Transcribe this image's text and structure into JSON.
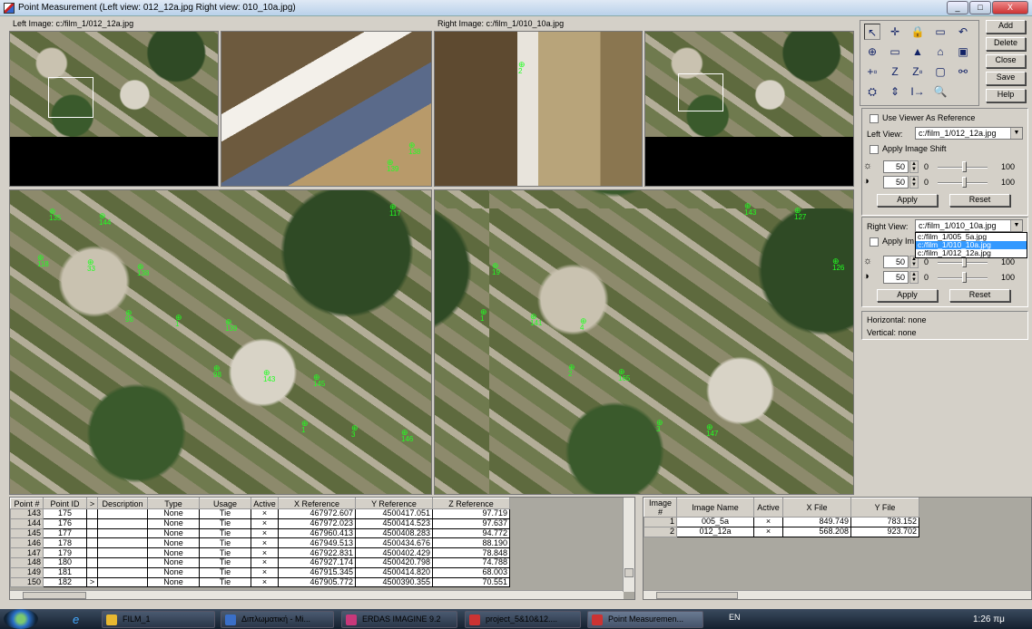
{
  "window": {
    "title": "Point Measurement (Left view: 012_12a.jpg  Right view: 010_10a.jpg)",
    "controls": [
      "_",
      "□",
      "X"
    ]
  },
  "views": {
    "left_label": "Left Image: c:/film_1/012_12a.jpg",
    "right_label": "Right Image: c:/film_1/010_10a.jpg",
    "markers_left_zoom": [
      "139"
    ],
    "markers_right_zoom": [
      "138",
      "2"
    ],
    "markers_left_main": [
      "118",
      "96",
      "98",
      "1",
      "117",
      "33",
      "1",
      "143",
      "3",
      "135",
      "138",
      "139",
      "145",
      "146",
      "144"
    ],
    "markers_right_main": [
      "1",
      "2",
      "3",
      "143",
      "126",
      "141",
      "165",
      "147",
      "127",
      "19",
      "4"
    ]
  },
  "tools": {
    "icons": [
      "select-arrow-icon",
      "crosshair-icon",
      "lock-icon",
      "viewer-icon",
      "undo-icon",
      "zoom-link-icon",
      "add-viewer-icon",
      "triangle-icon",
      "drive-icon",
      "layout-icon",
      "add-point-icon",
      "z-icon",
      "z-window-icon",
      "box-icon",
      "link-icon",
      "elevation-icon",
      "swap-icon",
      "transfer-icon",
      "find-icon"
    ],
    "glyphs": [
      "↖",
      "✛",
      "🔒",
      "▭",
      "↶",
      "⊕",
      "▭",
      "▲",
      "⌂",
      "▣",
      "+▫",
      "Z",
      "Z▫",
      "▢",
      "⚯",
      "⛭",
      "⇕",
      "I→",
      "🔍"
    ]
  },
  "buttons": {
    "add": "Add",
    "delete": "Delete",
    "close": "Close",
    "save": "Save",
    "help": "Help"
  },
  "left_controls": {
    "use_viewer_ref": "Use Viewer As Reference",
    "left_view_label": "Left View:",
    "left_view_value": "c:/film_1/012_12a.jpg",
    "apply_shift": "Apply Image Shift",
    "brightness": "50",
    "contrast": "50",
    "min": "0",
    "max": "100",
    "brightness_level": 50,
    "contrast_level": 50,
    "apply": "Apply",
    "reset": "Reset"
  },
  "right_controls": {
    "right_view_label": "Right View:",
    "right_view_value": "c:/film_1/010_10a.jpg",
    "apply_shift": "Apply Im",
    "brightness": "50",
    "contrast": "50",
    "min": "0",
    "max": "100",
    "brightness_level": 50,
    "contrast_level": 50,
    "apply": "Apply",
    "reset": "Reset",
    "dropdown_options": [
      "c:/film_1/005_5a.jpg",
      "c:/film_1/010_10a.jpg",
      "c:/film_1/012_12a.jpg"
    ],
    "dropdown_selected": 1
  },
  "info": {
    "horizontal": "Horizontal: none",
    "vertical": "Vertical: none"
  },
  "points_table": {
    "headers": [
      "Point #",
      "Point ID",
      ">",
      "Description",
      "Type",
      "Usage",
      "Active",
      "X Reference",
      "Y Reference",
      "Z Reference"
    ],
    "rows": [
      [
        "143",
        "175",
        "",
        "",
        "None",
        "Tie",
        "×",
        "467972.607",
        "4500417.051",
        "97.719"
      ],
      [
        "144",
        "176",
        "",
        "",
        "None",
        "Tie",
        "×",
        "467972.023",
        "4500414.523",
        "97.637"
      ],
      [
        "145",
        "177",
        "",
        "",
        "None",
        "Tie",
        "×",
        "467960.413",
        "4500408.283",
        "94.772"
      ],
      [
        "146",
        "178",
        "",
        "",
        "None",
        "Tie",
        "×",
        "467949.513",
        "4500434.676",
        "88.190"
      ],
      [
        "147",
        "179",
        "",
        "",
        "None",
        "Tie",
        "×",
        "467922.831",
        "4500402.429",
        "78.848"
      ],
      [
        "148",
        "180",
        "",
        "",
        "None",
        "Tie",
        "×",
        "467927.174",
        "4500420.798",
        "74.788"
      ],
      [
        "149",
        "181",
        "",
        "",
        "None",
        "Tie",
        "×",
        "467915.345",
        "4500414.820",
        "68.003"
      ],
      [
        "150",
        "182",
        ">",
        "",
        "None",
        "Tie",
        "×",
        "467905.772",
        "4500390.355",
        "70.551"
      ]
    ]
  },
  "images_table": {
    "headers": [
      "Image #",
      "Image Name",
      "Active",
      "X File",
      "Y File"
    ],
    "rows": [
      [
        "1",
        "005_5a",
        "×",
        "849.749",
        "783.152"
      ],
      [
        "2",
        "012_12a",
        "×",
        "568.208",
        "923.702"
      ]
    ]
  },
  "taskbar": {
    "items": [
      "FILM_1",
      "Διπλωματική - Mi...",
      "ERDAS IMAGINE 9.2",
      "project_5&10&12....",
      "Point Measuremen..."
    ],
    "active": 4,
    "lang": "EN",
    "clock": "1:26 πμ"
  }
}
